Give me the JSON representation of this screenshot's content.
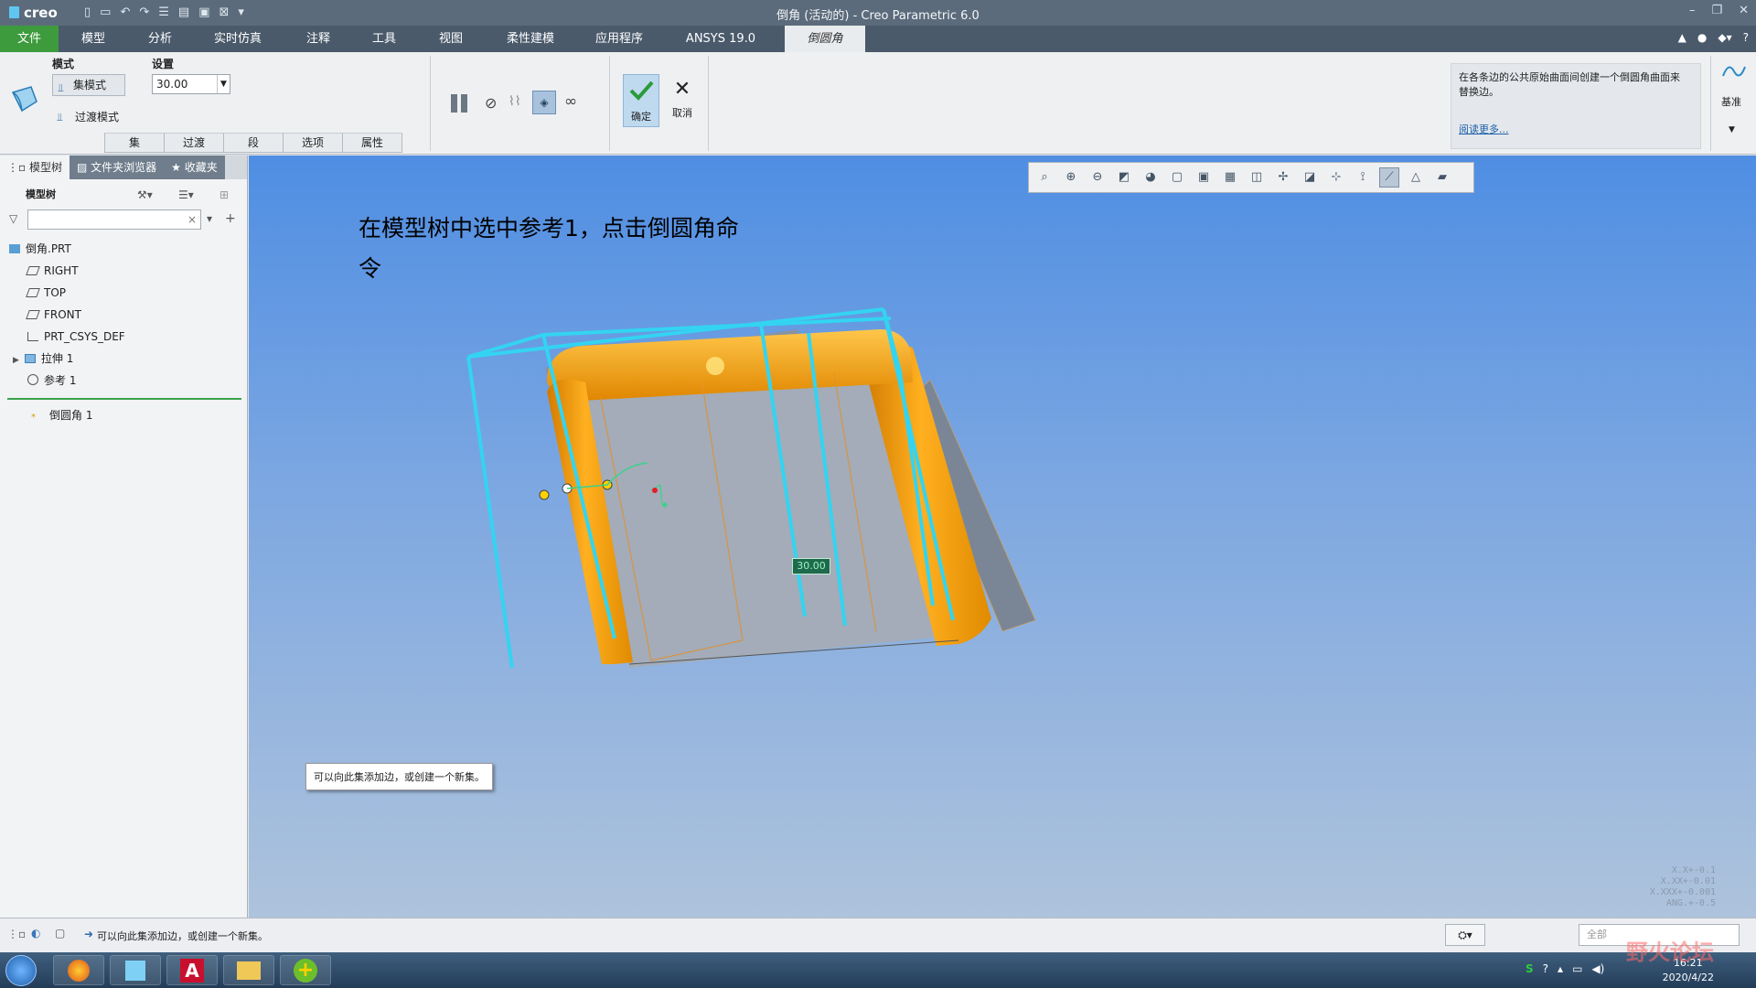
{
  "app": {
    "logo": "creo",
    "window_title": "倒角 (活动的) - Creo Parametric 6.0"
  },
  "tabs": [
    {
      "label": "文件"
    },
    {
      "label": "模型"
    },
    {
      "label": "分析"
    },
    {
      "label": "实时仿真"
    },
    {
      "label": "注释"
    },
    {
      "label": "工具"
    },
    {
      "label": "视图"
    },
    {
      "label": "柔性建模"
    },
    {
      "label": "应用程序"
    },
    {
      "label": "ANSYS 19.0"
    },
    {
      "label": "倒圆角"
    }
  ],
  "ribbon": {
    "mode_label": "模式",
    "set_mode": "集模式",
    "transition_mode": "过渡模式",
    "settings_label": "设置",
    "radius_value": "30.00",
    "ok_label": "确定",
    "cancel_label": "取消",
    "subtabs": [
      "集",
      "过渡",
      "段",
      "选项",
      "属性"
    ],
    "info_text": "在各条边的公共原始曲面间创建一个倒圆角曲面来替换边。",
    "read_more": "阅读更多...",
    "datum_label": "基准"
  },
  "left_pane": {
    "tabs": [
      "模型树",
      "文件夹浏览器",
      "收藏夹"
    ],
    "tree_label": "模型树",
    "search_placeholder": "",
    "items": [
      {
        "label": "倒角.PRT",
        "icon": "part-icon"
      },
      {
        "label": "RIGHT",
        "icon": "datum-plane-icon"
      },
      {
        "label": "TOP",
        "icon": "datum-plane-icon"
      },
      {
        "label": "FRONT",
        "icon": "datum-plane-icon"
      },
      {
        "label": "PRT_CSYS_DEF",
        "icon": "csys-icon"
      },
      {
        "label": "拉伸 1",
        "icon": "extrude-icon"
      },
      {
        "label": "参考 1",
        "icon": "reference-icon"
      },
      {
        "label": "倒圆角 1",
        "icon": "round-icon"
      }
    ]
  },
  "viewport": {
    "instruction": "在模型树中选中参考1，点击倒圆角命令",
    "tooltip": "可以向此集添加边，或创建一个新集。",
    "dimension": "30.00",
    "tolerances": [
      "X.X+-0.1",
      "X.XX+-0.01",
      "X.XXX+-0.001",
      "ANG.+-0.5"
    ]
  },
  "status": {
    "message": "可以向此集添加边，或创建一个新集。",
    "filter_value": "全部"
  },
  "taskbar": {
    "time": "16:21",
    "date": "2020/4/22",
    "watermark": "野火论坛"
  },
  "colors": {
    "title_bar": "#5b6b7c",
    "tab_bar": "#4a5a6b",
    "file_tab": "#3d9b3d",
    "model_orange": "#ffa500",
    "edge_cyan": "#33d4f2"
  }
}
